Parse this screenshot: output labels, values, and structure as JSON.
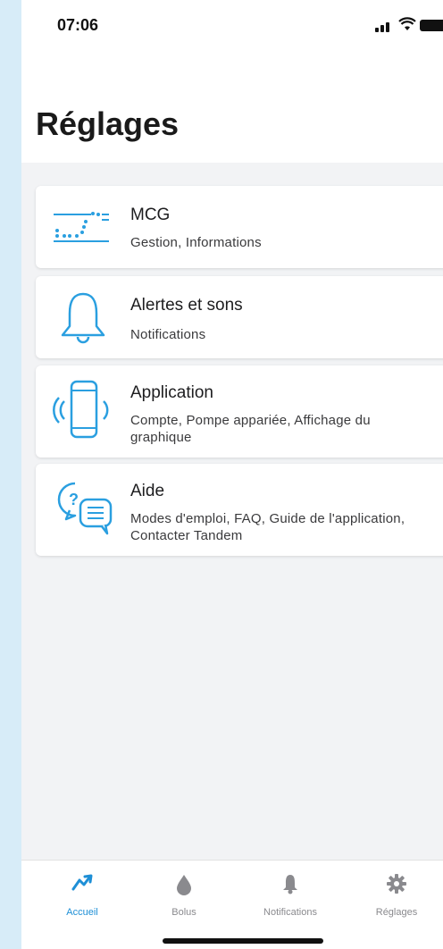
{
  "status_bar": {
    "time": "07:06"
  },
  "header": {
    "title": "Réglages"
  },
  "settings_items": [
    {
      "icon": "cgm-graph-icon",
      "title": "MCG",
      "subtitle": "Gestion, Informations"
    },
    {
      "icon": "bell-icon",
      "title": "Alertes et sons",
      "subtitle": "Notifications"
    },
    {
      "icon": "phone-icon",
      "title": "Application",
      "subtitle": "Compte, Pompe appariée, Affichage du graphique"
    },
    {
      "icon": "help-chat-icon",
      "title": "Aide",
      "subtitle": "Modes d'emploi, FAQ, Guide de l'application, Contacter Tandem"
    }
  ],
  "tabbar": {
    "tabs": [
      {
        "label": "Accueil",
        "icon": "trend-icon",
        "active": true
      },
      {
        "label": "Bolus",
        "icon": "drop-icon",
        "active": false
      },
      {
        "label": "Notifications",
        "icon": "bell-icon",
        "active": false
      },
      {
        "label": "Réglages",
        "icon": "gear-icon",
        "active": false
      }
    ]
  },
  "colors": {
    "accent": "#1e8fd6",
    "icon_blue": "#2a9fe0",
    "background": "#f2f3f5",
    "side_margin": "#d7ecf8"
  }
}
